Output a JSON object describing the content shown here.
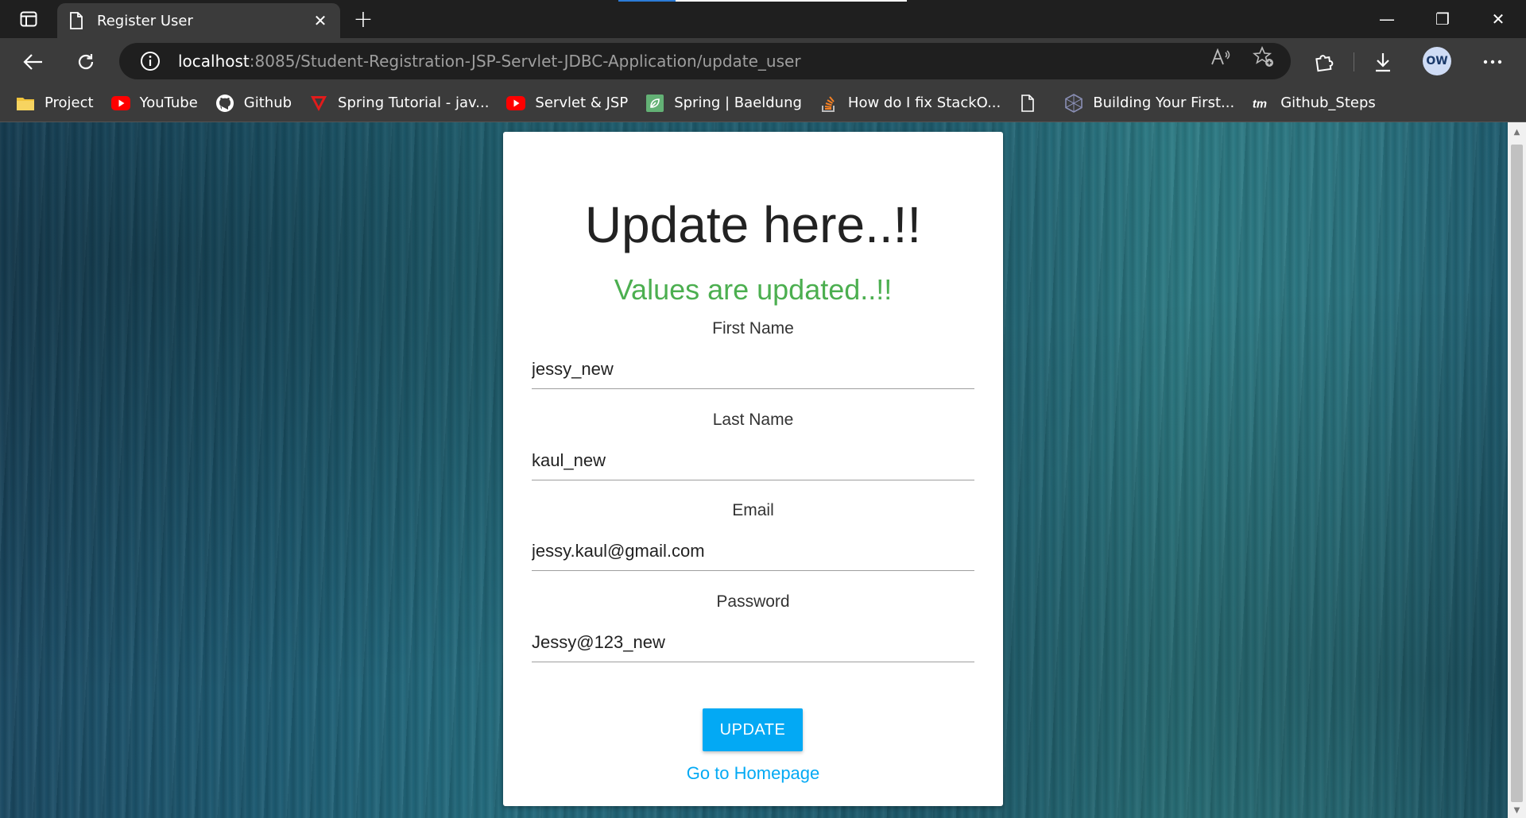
{
  "browser": {
    "tab": {
      "title": "Register User",
      "close_icon": "close-icon"
    },
    "window_controls": {
      "minimize": "—",
      "restore": "❐",
      "close": "✕"
    },
    "address_bar": {
      "host": "localhost",
      "path": ":8085/Student-Registration-JSP-Servlet-JDBC-Application/update_user"
    },
    "profile_initials": "OW",
    "bookmarks": [
      {
        "label": "Project",
        "icon": "folder-icon"
      },
      {
        "label": "YouTube",
        "icon": "youtube-icon"
      },
      {
        "label": "Github",
        "icon": "github-icon"
      },
      {
        "label": "Spring Tutorial - jav...",
        "icon": "spring-tutorial-icon"
      },
      {
        "label": "Servlet & JSP",
        "icon": "youtube-icon"
      },
      {
        "label": "Spring | Baeldung",
        "icon": "baeldung-icon"
      },
      {
        "label": "How do I fix StackO...",
        "icon": "stackoverflow-icon"
      },
      {
        "label": "",
        "icon": "page-icon"
      },
      {
        "label": "Building Your First...",
        "icon": "hexagon-icon"
      },
      {
        "label": "Github_Steps",
        "icon": "tm-icon"
      }
    ]
  },
  "form": {
    "title": "Update here..!!",
    "message": "Values are updated..!!",
    "fields": [
      {
        "label": "First Name",
        "value": "jessy_new"
      },
      {
        "label": "Last Name",
        "value": "kaul_new"
      },
      {
        "label": "Email",
        "value": "jessy.kaul@gmail.com"
      },
      {
        "label": "Password",
        "value": "Jessy@123_new"
      }
    ],
    "submit_label": "UPDATE",
    "home_link": "Go to Homepage"
  },
  "colors": {
    "success": "#4caf50",
    "accent": "#03a9f4"
  }
}
